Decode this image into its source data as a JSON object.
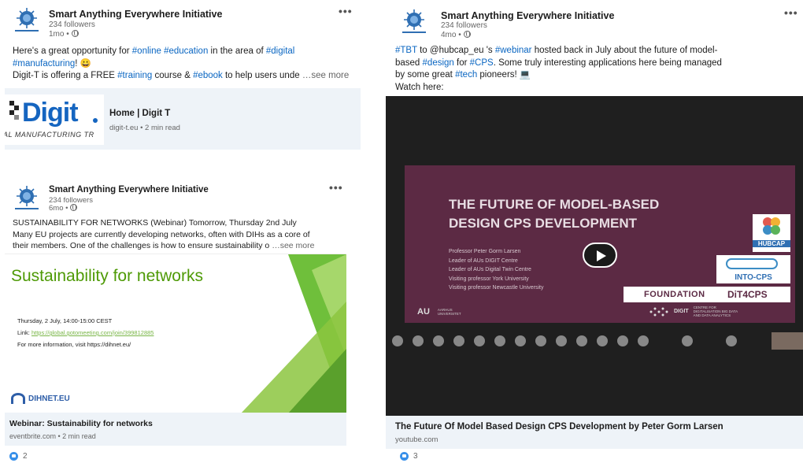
{
  "posts": [
    {
      "org": "Smart Anything Everywhere Initiative",
      "followers": "234 followers",
      "time": "1mo •",
      "text": {
        "l1_a": "Here's a great opportunity for ",
        "l1_t1": "#online",
        "l1_t2": "#education",
        "l1_b": " in the area of ",
        "l1_t3": "#digital",
        "l2_t1": "#manufacturing",
        "l2_a": "! 😀",
        "l3_a": "Digit-T is offering a FREE ",
        "l3_t1": "#training",
        "l3_b": " course & ",
        "l3_t2": "#ebook",
        "l3_c": " to help users unde",
        "see_more": "…see more"
      },
      "card": {
        "logo_text": "Digit",
        "logo_sub": "AL MANUFACTURING TR",
        "title": "Home | Digit T",
        "sub": "digit-t.eu • 2 min read"
      }
    },
    {
      "org": "Smart Anything Everywhere Initiative",
      "followers": "234 followers",
      "time": "6mo •",
      "text": {
        "l1": "SUSTAINABILITY FOR NETWORKS (Webinar) Tomorrow, Thursday 2nd July",
        "l2": "Many EU projects are currently developing networks, often with DIHs as a core of",
        "l3": "their members. One of the challenges is how to ensure sustainability o",
        "see_more": "…see more"
      },
      "image": {
        "heading": "Sustainability for networks",
        "line1": "Thursday, 2 July, 14:00-15:00 CEST",
        "line2_label": "Link: ",
        "line2_link": "https://global.gotomeeting.com/join/399812885",
        "line3": "For more information, visit https://dihnet.eu/",
        "brand": "DIHNET.EU"
      },
      "card": {
        "title": "Webinar: Sustainability for networks",
        "sub": "eventbrite.com • 2 min read"
      },
      "reactions": "2"
    },
    {
      "org": "Smart Anything Everywhere Initiative",
      "followers": "234 followers",
      "time": "4mo •",
      "text": {
        "l1_t1": "#TBT",
        "l1_a": " to @hubcap_eu 's ",
        "l1_t2": "#webinar",
        "l1_b": " hosted back in July about the future of model-",
        "l2_a": "based ",
        "l2_t1": "#design",
        "l2_b": " for ",
        "l2_t2": "#CPS",
        "l2_c": ". Some truly interesting applications here being managed",
        "l3_a": "by some great ",
        "l3_t1": "#tech",
        "l3_b": " pioneers! 💻",
        "l4": "Watch here:"
      },
      "video": {
        "title1": "THE FUTURE OF MODEL-BASED",
        "title2": "DESIGN CPS DEVELOPMENT",
        "bullets": [
          "Professor Peter Gorm Larsen",
          "Leader of AUs DIGIT Centre",
          "Leader of AUs Digital Twin Centre",
          "Visiting professor York University",
          "Visiting professor Newcastle University"
        ],
        "hubcap": "HUBCAP",
        "intocps": "INTO-CPS",
        "foundation": "FOUNDATION",
        "dit4cps": "DiT4CPS",
        "au": "AU",
        "au_sub": "AARHUS UNIVERSITET",
        "digit": "DIGIT",
        "digit_sub": "CENTRE FOR DIGITALISATION BIG DATA AND DATA ANALYTICS"
      },
      "card": {
        "title": "The Future Of Model Based Design CPS Development by Peter Gorm Larsen",
        "sub": "youtube.com"
      },
      "reactions": "3"
    }
  ],
  "menu_icon": "•••",
  "colors": {
    "accent": "#0a66c2",
    "card_bg": "#eef3f8",
    "green": "#4e9a06",
    "video_bg": "#1f1f1f",
    "slide_bg": "#5c2a44"
  }
}
